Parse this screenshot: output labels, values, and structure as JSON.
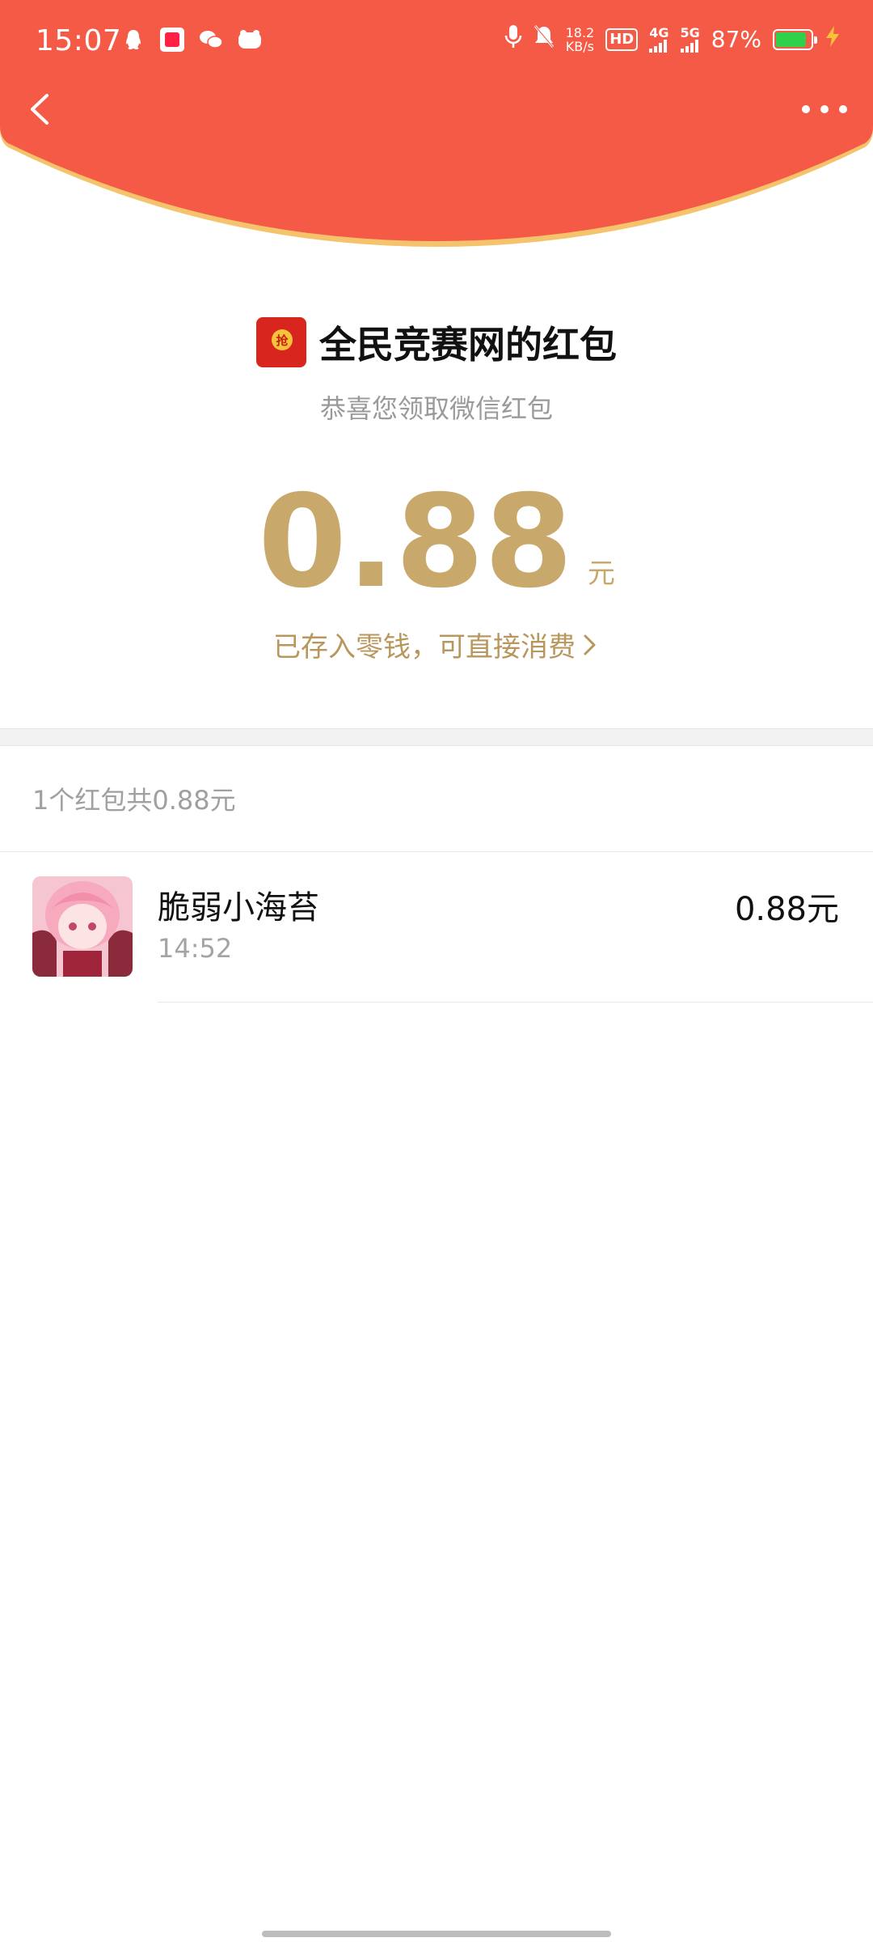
{
  "status_bar": {
    "time": "15:07",
    "net_speed_value": "18.2",
    "net_speed_unit": "KB/s",
    "hd_badge": "HD",
    "network_4g": "4G",
    "network_5g": "5G",
    "battery_percent": "87%",
    "battery_level": 0.87
  },
  "header": {
    "background_color": "#f55a46",
    "rim_color": "#f4c36c"
  },
  "red_packet": {
    "icon_glyph": "抢",
    "title": "全民竞赛网的红包",
    "subtitle": "恭喜您领取微信红包",
    "amount": "0.88",
    "unit": "元",
    "deposit_link": "已存入零钱，可直接消费"
  },
  "summary": {
    "text": "1个红包共0.88元"
  },
  "records": [
    {
      "name": "脆弱小海苔",
      "time": "14:52",
      "amount": "0.88元"
    }
  ],
  "colors": {
    "accent_gold": "#c8a86b",
    "link_gold": "#b8975d"
  }
}
